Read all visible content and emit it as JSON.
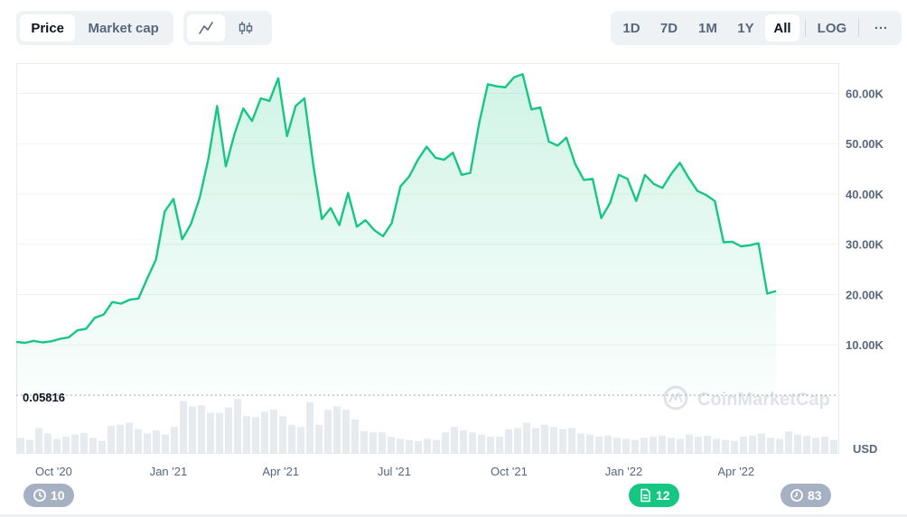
{
  "controls": {
    "type_toggle": {
      "price_label": "Price",
      "market_cap_label": "Market cap",
      "active": "Price"
    },
    "chart_style": {
      "line_icon": "line-chart-icon",
      "candle_icon": "candlestick-icon",
      "active": "line"
    },
    "ranges": [
      "1D",
      "7D",
      "1M",
      "1Y",
      "All"
    ],
    "active_range": "All",
    "log_label": "LOG",
    "more_label": "···"
  },
  "chart_data": {
    "type": "area",
    "title": "",
    "xlabel": "",
    "ylabel": "",
    "currency_label": "USD",
    "y_ticks": [
      "10.00K",
      "20.00K",
      "30.00K",
      "40.00K",
      "50.00K",
      "60.00K"
    ],
    "y_tick_values": [
      10000,
      20000,
      30000,
      40000,
      50000,
      60000
    ],
    "ylim": [
      0,
      66000
    ],
    "x_ticks": [
      "Oct '20",
      "Jan '21",
      "Apr '21",
      "Jul '21",
      "Oct '21",
      "Jan '22",
      "Apr '22"
    ],
    "x_tick_dates": [
      "2020-10-01",
      "2021-01-01",
      "2021-04-01",
      "2021-07-01",
      "2021-10-01",
      "2022-01-01",
      "2022-04-01"
    ],
    "xlim": [
      "2020-09-01",
      "2022-06-22"
    ],
    "grid": true,
    "baseline_label": "0.05816",
    "watermark": "CoinMarketCap",
    "series": [
      {
        "color": "#16c784",
        "points": [
          [
            "2020-09-01",
            10600
          ],
          [
            "2020-09-08",
            10400
          ],
          [
            "2020-09-15",
            10800
          ],
          [
            "2020-09-22",
            10500
          ],
          [
            "2020-09-29",
            10700
          ],
          [
            "2020-10-06",
            11200
          ],
          [
            "2020-10-13",
            11500
          ],
          [
            "2020-10-20",
            12900
          ],
          [
            "2020-10-27",
            13200
          ],
          [
            "2020-11-03",
            15400
          ],
          [
            "2020-11-10",
            16000
          ],
          [
            "2020-11-17",
            18500
          ],
          [
            "2020-11-24",
            18200
          ],
          [
            "2020-12-01",
            19000
          ],
          [
            "2020-12-08",
            19200
          ],
          [
            "2020-12-15",
            23200
          ],
          [
            "2020-12-22",
            27000
          ],
          [
            "2020-12-29",
            36500
          ],
          [
            "2021-01-05",
            39000
          ],
          [
            "2021-01-12",
            31000
          ],
          [
            "2021-01-19",
            34000
          ],
          [
            "2021-01-26",
            39200
          ],
          [
            "2021-02-02",
            47000
          ],
          [
            "2021-02-09",
            57500
          ],
          [
            "2021-02-16",
            45500
          ],
          [
            "2021-02-23",
            52000
          ],
          [
            "2021-03-02",
            57000
          ],
          [
            "2021-03-09",
            54500
          ],
          [
            "2021-03-16",
            59000
          ],
          [
            "2021-03-23",
            58500
          ],
          [
            "2021-03-30",
            63000
          ],
          [
            "2021-04-06",
            51500
          ],
          [
            "2021-04-13",
            57500
          ],
          [
            "2021-04-20",
            59000
          ],
          [
            "2021-04-27",
            46000
          ],
          [
            "2021-05-04",
            35000
          ],
          [
            "2021-05-11",
            37200
          ],
          [
            "2021-05-18",
            33800
          ],
          [
            "2021-05-25",
            40200
          ],
          [
            "2021-06-01",
            33500
          ],
          [
            "2021-06-08",
            34800
          ],
          [
            "2021-06-15",
            32800
          ],
          [
            "2021-06-22",
            31600
          ],
          [
            "2021-06-29",
            34200
          ],
          [
            "2021-07-06",
            41500
          ],
          [
            "2021-07-13",
            43500
          ],
          [
            "2021-07-20",
            46800
          ],
          [
            "2021-07-27",
            49400
          ],
          [
            "2021-08-03",
            47200
          ],
          [
            "2021-08-10",
            46800
          ],
          [
            "2021-08-17",
            48200
          ],
          [
            "2021-08-24",
            43800
          ],
          [
            "2021-08-31",
            44200
          ],
          [
            "2021-09-07",
            54000
          ],
          [
            "2021-09-14",
            61800
          ],
          [
            "2021-09-21",
            61400
          ],
          [
            "2021-09-28",
            61200
          ],
          [
            "2021-10-05",
            63200
          ],
          [
            "2021-10-12",
            63800
          ],
          [
            "2021-10-19",
            56800
          ],
          [
            "2021-10-26",
            57200
          ],
          [
            "2021-11-02",
            50400
          ],
          [
            "2021-11-09",
            49600
          ],
          [
            "2021-11-16",
            51200
          ],
          [
            "2021-11-23",
            46000
          ],
          [
            "2021-11-30",
            42800
          ],
          [
            "2021-12-07",
            43000
          ],
          [
            "2021-12-14",
            35200
          ],
          [
            "2021-12-21",
            38200
          ],
          [
            "2021-12-28",
            43800
          ],
          [
            "2022-01-04",
            43000
          ],
          [
            "2022-01-11",
            38600
          ],
          [
            "2022-01-18",
            43800
          ],
          [
            "2022-01-25",
            42000
          ],
          [
            "2022-02-01",
            41200
          ],
          [
            "2022-02-08",
            44000
          ],
          [
            "2022-02-15",
            46200
          ],
          [
            "2022-02-22",
            43200
          ],
          [
            "2022-03-01",
            40600
          ],
          [
            "2022-03-08",
            39800
          ],
          [
            "2022-03-15",
            38600
          ],
          [
            "2022-03-22",
            30400
          ],
          [
            "2022-03-29",
            30500
          ],
          [
            "2022-04-05",
            29600
          ],
          [
            "2022-04-12",
            29800
          ],
          [
            "2022-04-19",
            30200
          ],
          [
            "2022-04-26",
            20200
          ],
          [
            "2022-05-03",
            20700
          ]
        ]
      }
    ],
    "volume_relative": [
      0.28,
      0.24,
      0.46,
      0.36,
      0.26,
      0.3,
      0.34,
      0.37,
      0.28,
      0.22,
      0.5,
      0.52,
      0.56,
      0.44,
      0.36,
      0.42,
      0.34,
      0.48,
      0.96,
      0.86,
      0.88,
      0.74,
      0.74,
      0.84,
      1.0,
      0.68,
      0.66,
      0.76,
      0.8,
      0.68,
      0.52,
      0.48,
      0.94,
      0.52,
      0.8,
      0.86,
      0.8,
      0.62,
      0.4,
      0.38,
      0.38,
      0.3,
      0.26,
      0.24,
      0.22,
      0.26,
      0.24,
      0.38,
      0.48,
      0.42,
      0.38,
      0.34,
      0.3,
      0.3,
      0.44,
      0.46,
      0.56,
      0.46,
      0.52,
      0.48,
      0.44,
      0.46,
      0.36,
      0.34,
      0.3,
      0.32,
      0.28,
      0.26,
      0.24,
      0.28,
      0.3,
      0.32,
      0.28,
      0.26,
      0.34,
      0.3,
      0.32,
      0.26,
      0.24,
      0.22,
      0.3,
      0.32,
      0.36,
      0.28,
      0.26,
      0.4,
      0.34,
      0.32,
      0.28,
      0.3,
      0.24
    ]
  },
  "markers": {
    "left": {
      "icon": "history-icon",
      "count": "10"
    },
    "middle": {
      "icon": "document-icon",
      "count": "12"
    },
    "right": {
      "icon": "clock-icon",
      "count": "83"
    }
  }
}
